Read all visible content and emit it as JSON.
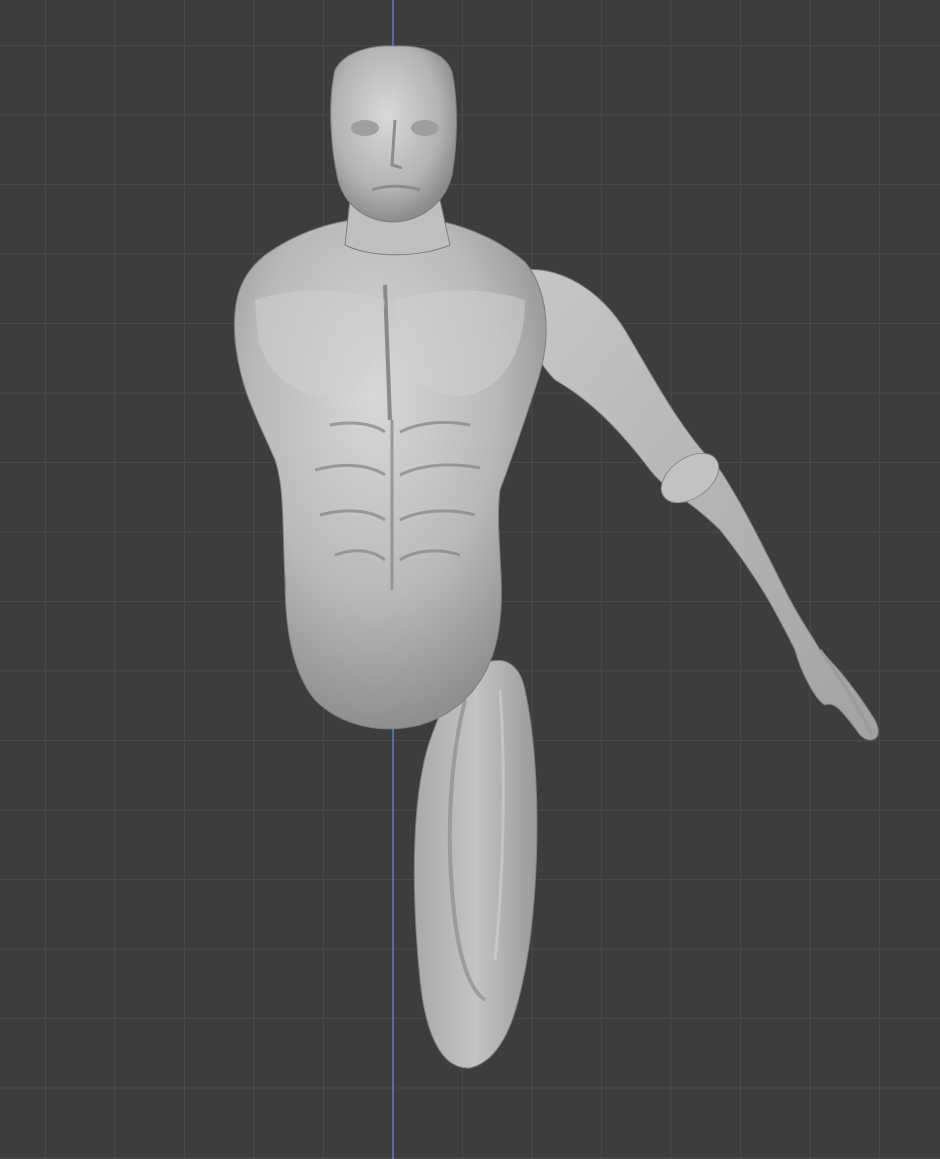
{
  "viewport": {
    "background_color": "#3d3d3d",
    "grid_color": "#4a4a4a",
    "axis_color": "#4a78c8",
    "model_color": "#b8b8b8",
    "model_highlight": "#d9d9d9",
    "model_shadow": "#8a8a8a"
  },
  "scene": {
    "object": "sculpted-human-torso-mesh",
    "grid_visible": true,
    "vertical_axis_visible": true
  }
}
